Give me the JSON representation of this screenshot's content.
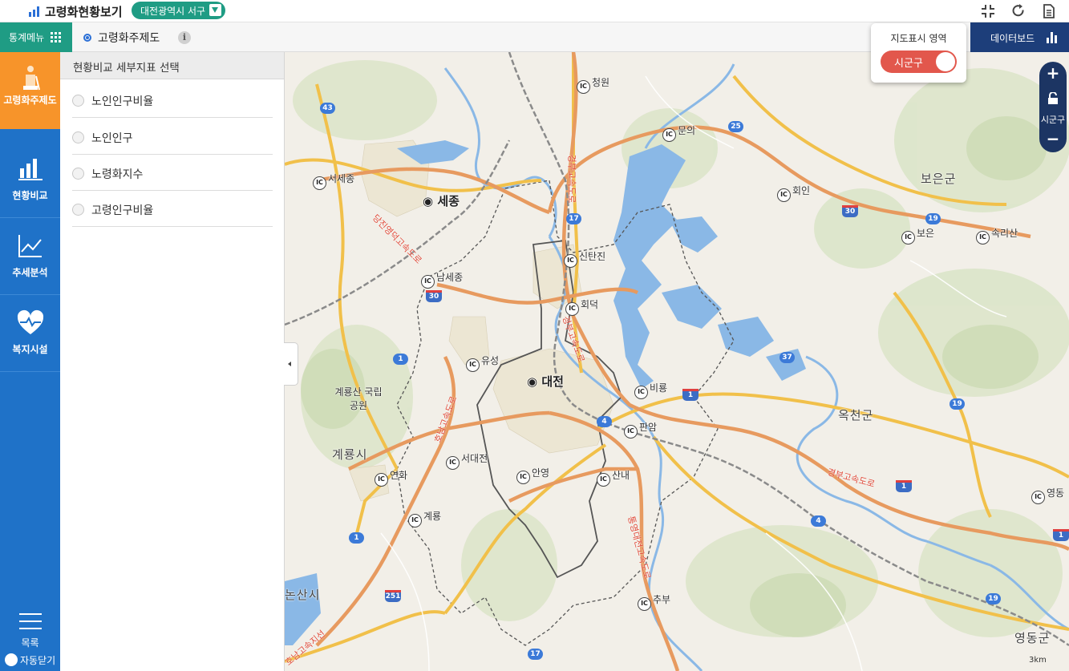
{
  "header": {
    "title": "고령화현황보기",
    "region": "대전광역시 서구"
  },
  "subbar": {
    "menu_label": "통계메뉴",
    "crumb": "고령화주제도",
    "info": "i",
    "dashboard_label": "데이터보드"
  },
  "sidebar": {
    "items": [
      {
        "label": "고령화주제도",
        "icon": "elderly-icon"
      },
      {
        "label": "현황비교",
        "icon": "bar-chart-icon"
      },
      {
        "label": "추세분석",
        "icon": "line-chart-icon"
      },
      {
        "label": "복지시설",
        "icon": "heart-pulse-icon"
      }
    ],
    "list_label": "목록",
    "auto_close_label": "자동닫기"
  },
  "panel": {
    "title": "현황비교 세부지표 선택",
    "options": [
      "노인인구비율",
      "노인인구",
      "노령화지수",
      "고령인구비율"
    ]
  },
  "toggle": {
    "title": "지도표시 영역",
    "value": "시군구"
  },
  "zoom": {
    "plus": "+",
    "minus": "−",
    "level_label": "시군구"
  },
  "map": {
    "scale": "3km",
    "cities": {
      "sejong": "세종",
      "daejeon": "대전"
    },
    "regions": {
      "boeun": "보은군",
      "okcheon": "옥천군",
      "gyeryong": "계룡시",
      "nonsan": "논산시",
      "yeongdong": "영동군",
      "park": "계룡산 국립공원"
    },
    "ic": {
      "cheongwon": "청원",
      "munui": "문의",
      "hoein": "회인",
      "boeun": "보은",
      "songnisan": "속리산",
      "seosejong": "서세종",
      "namsejong": "남세종",
      "sintanjin": "신탄진",
      "hoedeok": "회덕",
      "yuseong": "유성",
      "biryong": "비룡",
      "panam": "판암",
      "seodaejeon": "서대전",
      "yeonhwa": "연화",
      "anyeong": "안영",
      "sannae": "산내",
      "gyeryong": "계룡",
      "chubu": "추부",
      "yeongdong": "영동"
    },
    "routes": {
      "r43": "43",
      "r25": "25",
      "r17a": "17",
      "r19a": "19",
      "r30a": "30",
      "r30b": "30",
      "r1a": "1",
      "r37": "37",
      "r1b": "1",
      "r4a": "4",
      "r19b": "19",
      "r1c": "1",
      "r4b": "4",
      "r1d": "1",
      "r251": "251",
      "r19c": "19",
      "r17b": "17",
      "r1e": "1"
    },
    "road_names": {
      "n1": "경부고속도로",
      "n2": "경부고속도로",
      "n3": "당진영덕고속도로",
      "n4": "호남고속도로",
      "n5": "통영대전고속도로",
      "n6": "경부고속도로",
      "n7": "호남고속지선"
    }
  }
}
